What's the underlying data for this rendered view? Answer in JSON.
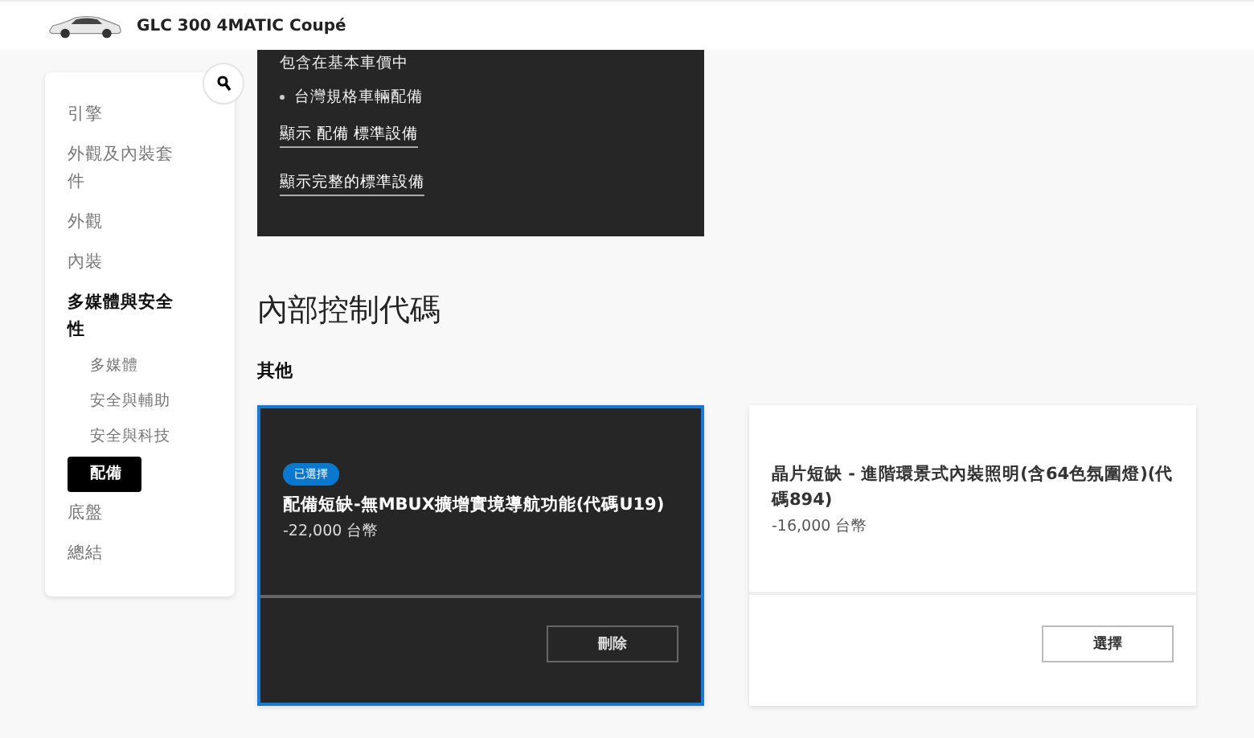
{
  "header": {
    "title": "GLC 300 4MATIC Coupé"
  },
  "sidebar": {
    "items": [
      {
        "label": "引擎",
        "selected": false
      },
      {
        "label": "外觀及內裝套件",
        "selected": false
      },
      {
        "label": "外觀",
        "selected": false
      },
      {
        "label": "內裝",
        "selected": false
      },
      {
        "label": "多媒體與安全性",
        "selected": true,
        "children": [
          {
            "label": "多媒體",
            "selected": false
          },
          {
            "label": "安全與輔助",
            "selected": false
          },
          {
            "label": "安全與科技",
            "selected": false
          },
          {
            "label": "配備",
            "selected": true
          }
        ]
      },
      {
        "label": "底盤",
        "selected": false
      },
      {
        "label": "總結",
        "selected": false
      }
    ]
  },
  "info_panel": {
    "note": "包含在基本車價中",
    "bullets": [
      "台灣規格車輛配備"
    ],
    "links": [
      "顯示 配備 標準設備",
      "顯示完整的標準設備"
    ]
  },
  "section": {
    "heading": "內部控制代碼",
    "subheading": "其他"
  },
  "options": [
    {
      "selected": true,
      "badge": "已選擇",
      "title": "配備短缺-無MBUX擴增實境導航功能(代碼U19)",
      "price": "-22,000 台幣",
      "button": "刪除"
    },
    {
      "selected": false,
      "title": "晶片短缺 - 進階環景式內裝照明(含64色氛圍燈)(代碼894)",
      "price": "-16,000 台幣",
      "button": "選擇"
    }
  ]
}
